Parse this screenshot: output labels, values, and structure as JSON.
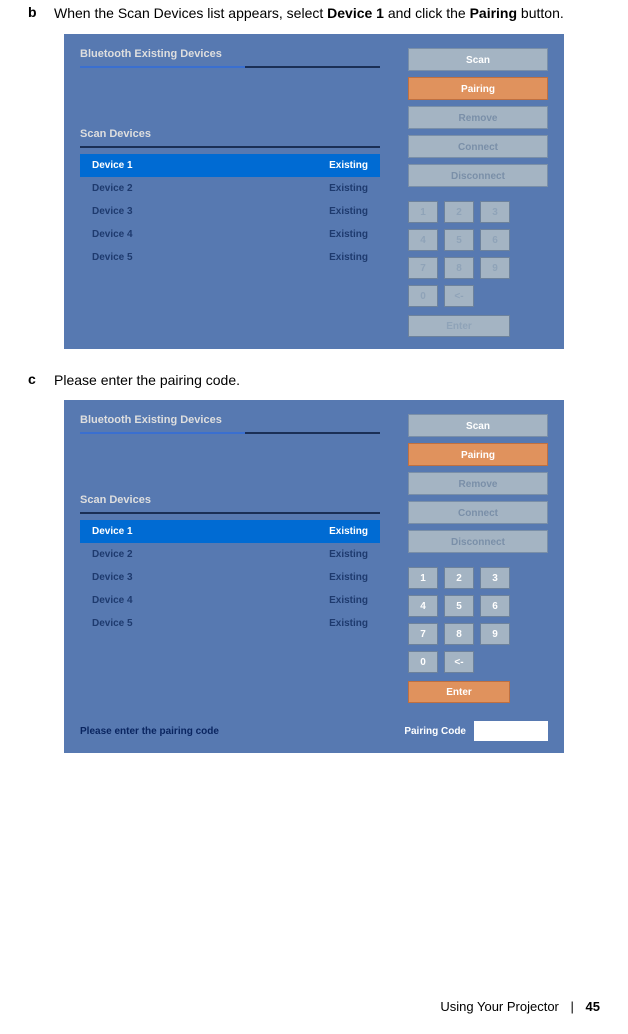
{
  "step_b": {
    "letter": "b",
    "text_before": "When the Scan Devices list appears, select ",
    "bold1": "Device 1",
    "text_middle": " and click the ",
    "bold2": "Pairing",
    "text_after": " button."
  },
  "step_c": {
    "letter": "c",
    "text": "Please enter the pairing code."
  },
  "ui": {
    "existing_title": "Bluetooth Existing Devices",
    "scan_title": "Scan Devices",
    "buttons": {
      "scan": "Scan",
      "pairing": "Pairing",
      "remove": "Remove",
      "connect": "Connect",
      "disconnect": "Disconnect"
    },
    "devices": [
      {
        "name": "Device 1",
        "status": "Existing",
        "selected": true
      },
      {
        "name": "Device 2",
        "status": "Existing",
        "selected": false
      },
      {
        "name": "Device 3",
        "status": "Existing",
        "selected": false
      },
      {
        "name": "Device 4",
        "status": "Existing",
        "selected": false
      },
      {
        "name": "Device 5",
        "status": "Existing",
        "selected": false
      }
    ],
    "keys": [
      "1",
      "2",
      "3",
      "4",
      "5",
      "6",
      "7",
      "8",
      "9",
      "0",
      "<-"
    ],
    "enter": "Enter",
    "prompt": "Please enter the pairing code",
    "code_label": "Pairing Code"
  },
  "footer": {
    "section": "Using Your Projector",
    "divider": "|",
    "page": "45"
  }
}
